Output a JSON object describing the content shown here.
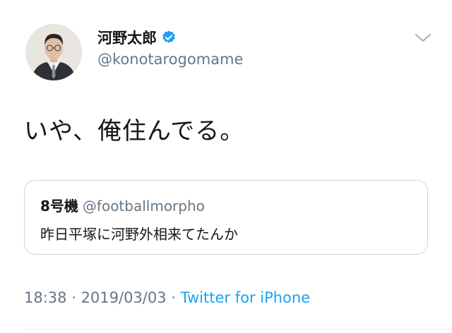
{
  "user": {
    "display_name": "河野太郎",
    "handle": "@konotarogomame"
  },
  "tweet": {
    "text": "いや、俺住んでる。"
  },
  "quoted_tweet": {
    "name": "8号機",
    "handle": "@footballmorpho",
    "text": "昨日平塚に河野外相来てたんか"
  },
  "meta": {
    "time": "18:38",
    "separator1": " · ",
    "date": "2019/03/03",
    "separator2": " · ",
    "source": "Twitter for iPhone"
  },
  "colors": {
    "accent": "#1da1f2",
    "secondary_text": "#657786",
    "border": "#ccd6dd"
  },
  "icons": {
    "verified": "verified-badge-icon",
    "menu": "chevron-down-icon"
  }
}
